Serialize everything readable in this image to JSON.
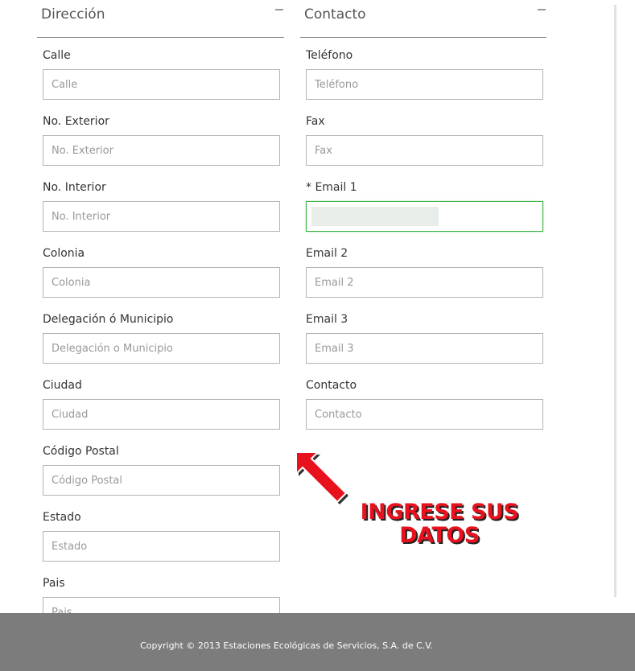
{
  "direccion": {
    "title": "Dirección",
    "fields": [
      {
        "label": "Calle",
        "placeholder": "Calle"
      },
      {
        "label": "No. Exterior",
        "placeholder": "No. Exterior"
      },
      {
        "label": "No. Interior",
        "placeholder": "No. Interior"
      },
      {
        "label": "Colonia",
        "placeholder": "Colonia"
      },
      {
        "label": "Delegación ó Municipio",
        "placeholder": "Delegación o Municipio"
      },
      {
        "label": "Ciudad",
        "placeholder": "Ciudad"
      },
      {
        "label": "Código Postal",
        "placeholder": "Código Postal"
      },
      {
        "label": "Estado",
        "placeholder": "Estado"
      },
      {
        "label": "Pais",
        "placeholder": "Pais"
      }
    ]
  },
  "contacto": {
    "title": "Contacto",
    "fields": [
      {
        "label": "Teléfono",
        "placeholder": "Teléfono"
      },
      {
        "label": "Fax",
        "placeholder": "Fax"
      },
      {
        "label": "* Email 1",
        "placeholder": "",
        "value": ""
      },
      {
        "label": "Email 2",
        "placeholder": "Email 2"
      },
      {
        "label": "Email 3",
        "placeholder": "Email 3"
      },
      {
        "label": "Contacto",
        "placeholder": "Contacto"
      }
    ]
  },
  "annotation": {
    "line1": "INGRESE SUS",
    "line2": "DATOS",
    "color": "#e8121e"
  },
  "footer": {
    "copyright": "Copyright © 2013 Estaciones Ecológicas de Servicios, S.A. de C.V."
  },
  "colors": {
    "footer_bg": "#7c7c7c",
    "active_border": "#3cb043"
  }
}
